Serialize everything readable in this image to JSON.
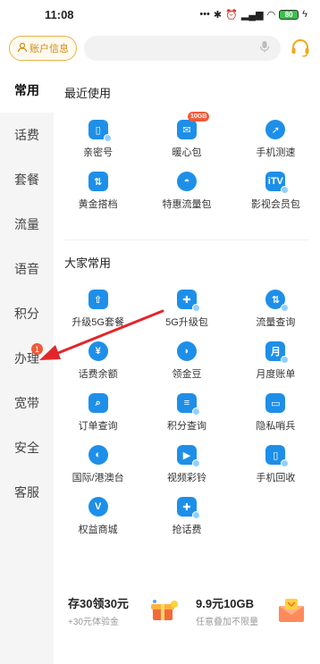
{
  "status": {
    "time": "11:08",
    "signal": "4G",
    "battery": "80"
  },
  "header": {
    "account_label": "账户信息",
    "search_placeholder": ""
  },
  "sidebar": {
    "items": [
      {
        "label": "常用",
        "active": true
      },
      {
        "label": "话费"
      },
      {
        "label": "套餐"
      },
      {
        "label": "流量"
      },
      {
        "label": "语音"
      },
      {
        "label": "积分"
      },
      {
        "label": "办理",
        "badge": "1"
      },
      {
        "label": "宽带"
      },
      {
        "label": "安全"
      },
      {
        "label": "客服"
      }
    ]
  },
  "recent": {
    "title": "最近使用",
    "badge": "10GB",
    "items": [
      {
        "label": "亲密号",
        "icon": "phone-icon"
      },
      {
        "label": "暖心包",
        "icon": "gift-pack-icon"
      },
      {
        "label": "手机测速",
        "icon": "speed-icon"
      },
      {
        "label": "黄金搭档",
        "icon": "partner-icon"
      },
      {
        "label": "特惠流量包",
        "icon": "data-pack-icon"
      },
      {
        "label": "影视会员包",
        "icon": "tv-icon"
      }
    ]
  },
  "common": {
    "title": "大家常用",
    "items": [
      {
        "label": "升级5G套餐",
        "icon": "upgrade-icon"
      },
      {
        "label": "5G升级包",
        "icon": "gift-icon"
      },
      {
        "label": "流量查询",
        "icon": "data-query-icon"
      },
      {
        "label": "话费余额",
        "icon": "yuan-icon"
      },
      {
        "label": "领金豆",
        "icon": "bean-icon"
      },
      {
        "label": "月度账单",
        "icon": "bill-icon"
      },
      {
        "label": "订单查询",
        "icon": "order-icon"
      },
      {
        "label": "积分查询",
        "icon": "points-icon"
      },
      {
        "label": "隐私哨兵",
        "icon": "privacy-icon"
      },
      {
        "label": "国际/港澳台",
        "icon": "globe-icon"
      },
      {
        "label": "视频彩铃",
        "icon": "video-ring-icon"
      },
      {
        "label": "手机回收",
        "icon": "recycle-icon"
      },
      {
        "label": "权益商城",
        "icon": "mall-icon"
      },
      {
        "label": "抢话费",
        "icon": "grab-credit-icon"
      }
    ]
  },
  "promos": [
    {
      "title": "存30领30元",
      "subtitle": "+30元体验金"
    },
    {
      "title": "9.9元10GB",
      "subtitle": "任意叠加不限量"
    }
  ],
  "colors": {
    "accent": "#1e8fe8",
    "arrow": "#e3262a",
    "badge": "#f05a3a"
  }
}
